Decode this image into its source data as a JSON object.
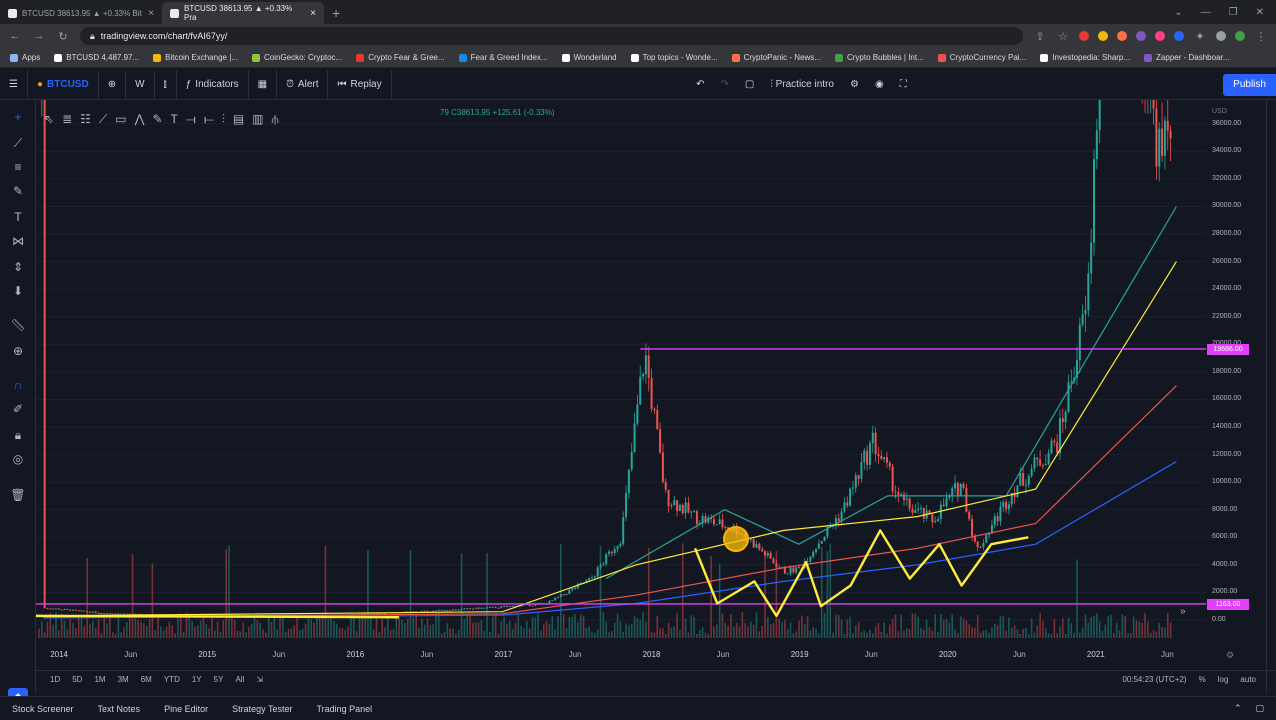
{
  "browser": {
    "tabs": [
      {
        "title": "BTCUSD 38613.95 ▲ +0.33% Bit",
        "active": false
      },
      {
        "title": "BTCUSD 38613.95 ▲ +0.33% Pra",
        "active": true
      }
    ],
    "new_tab": "+",
    "url": "tradingview.com/chart/fvAI67yy/",
    "bookmarks": [
      {
        "label": "Apps",
        "color": "#8ab4f8"
      },
      {
        "label": "BTCUSD 4,487.97...",
        "color": "#ffffff"
      },
      {
        "label": "Bitcoin Exchange |...",
        "color": "#f0b90b"
      },
      {
        "label": "CoinGecko: Cryptoc...",
        "color": "#8dc63f"
      },
      {
        "label": "Crypto Fear & Gree...",
        "color": "#e53935"
      },
      {
        "label": "Fear & Greed Index...",
        "color": "#1e88e5"
      },
      {
        "label": "Wonderland",
        "color": "#ffffff"
      },
      {
        "label": "Top topics - Wonde...",
        "color": "#ffffff"
      },
      {
        "label": "CryptoPanic - News...",
        "color": "#ff7043"
      },
      {
        "label": "Crypto Bubbles | Int...",
        "color": "#43a047"
      },
      {
        "label": "CryptoCurrency Pai...",
        "color": "#ef5350"
      },
      {
        "label": "Investopedia: Sharp...",
        "color": "#ffffff"
      },
      {
        "label": "Zapper - Dashboar...",
        "color": "#7e57c2"
      }
    ]
  },
  "tv": {
    "symbol": "BTCUSD",
    "interval": "W",
    "indicators": "Indicators",
    "alert": "Alert",
    "replay": "Replay",
    "practice": "Practice intro",
    "publish": "Publish",
    "legend": "79 C38613.95 +125.61 (-0.33%)",
    "currency": "USD"
  },
  "colors": {
    "background": "#131722",
    "up": "#26a69a",
    "down": "#ef5350",
    "accent": "#2962ff",
    "level": "#e040fb",
    "highlight": "#ffeb3b"
  },
  "chart_data": {
    "type": "line",
    "x_ticks": [
      "2014",
      "Jun",
      "2015",
      "Jun",
      "2016",
      "Jun",
      "2017",
      "Jun",
      "2018",
      "Jun",
      "2019",
      "Jun",
      "2020",
      "Jun",
      "2021",
      "Jun"
    ],
    "y_ticks": [
      "36000.00",
      "34000.00",
      "32000.00",
      "30000.00",
      "28000.00",
      "26000.00",
      "24000.00",
      "22000.00",
      "20000.00",
      "18000.00",
      "16000.00",
      "14000.00",
      "12000.00",
      "10000.00",
      "8000.00",
      "6000.00",
      "4000.00",
      "2000.00",
      "0.00"
    ],
    "ylim": [
      0,
      37000
    ],
    "price_tags": [
      {
        "label": "19666.00",
        "value": 19666
      },
      {
        "label": "1163.00",
        "value": 1163
      }
    ],
    "price_path": [
      [
        2013.9,
        900
      ],
      [
        2014.3,
        500
      ],
      [
        2015.0,
        250
      ],
      [
        2015.5,
        260
      ],
      [
        2016.0,
        420
      ],
      [
        2016.5,
        650
      ],
      [
        2017.0,
        950
      ],
      [
        2017.3,
        1200
      ],
      [
        2017.6,
        3000
      ],
      [
        2017.8,
        6000
      ],
      [
        2017.96,
        19500
      ],
      [
        2018.1,
        9000
      ],
      [
        2018.3,
        7500
      ],
      [
        2018.6,
        6500
      ],
      [
        2018.9,
        3500
      ],
      [
        2019.0,
        3700
      ],
      [
        2019.3,
        8000
      ],
      [
        2019.5,
        13000
      ],
      [
        2019.7,
        8500
      ],
      [
        2019.9,
        7200
      ],
      [
        2020.1,
        10000
      ],
      [
        2020.2,
        5000
      ],
      [
        2020.45,
        9500
      ],
      [
        2020.75,
        13000
      ],
      [
        2020.95,
        23000
      ],
      [
        2021.1,
        56000
      ],
      [
        2021.45,
        33000
      ],
      [
        2021.55,
        38600
      ]
    ],
    "ma_series": [
      {
        "color": "#26a69a",
        "values": [
          [
            2017.7,
            3000
          ],
          [
            2018.5,
            8000
          ],
          [
            2019.0,
            5500
          ],
          [
            2019.6,
            9000
          ],
          [
            2020.4,
            9000
          ],
          [
            2021.55,
            30000
          ]
        ]
      },
      {
        "color": "#ffeb3b",
        "values": [
          [
            2013.9,
            300
          ],
          [
            2017.0,
            600
          ],
          [
            2017.9,
            4000
          ],
          [
            2018.9,
            6500
          ],
          [
            2019.8,
            7500
          ],
          [
            2020.6,
            9500
          ],
          [
            2021.55,
            26000
          ]
        ]
      },
      {
        "color": "#ef5350",
        "values": [
          [
            2013.9,
            200
          ],
          [
            2017.0,
            450
          ],
          [
            2017.9,
            1800
          ],
          [
            2018.9,
            3800
          ],
          [
            2019.8,
            5200
          ],
          [
            2020.6,
            7000
          ],
          [
            2021.55,
            17000
          ]
        ]
      },
      {
        "color": "#2962ff",
        "values": [
          [
            2013.9,
            150
          ],
          [
            2017.0,
            350
          ],
          [
            2017.9,
            1200
          ],
          [
            2018.9,
            2800
          ],
          [
            2019.8,
            4000
          ],
          [
            2020.6,
            5500
          ],
          [
            2021.55,
            11500
          ]
        ]
      }
    ]
  },
  "ranges": [
    "1D",
    "5D",
    "1M",
    "3M",
    "6M",
    "YTD",
    "1Y",
    "5Y",
    "All"
  ],
  "clock": "00:54:23 (UTC+2)",
  "scale_toggles": [
    "%",
    "log",
    "auto"
  ],
  "bottom_tabs": [
    "Stock Screener",
    "Text Notes",
    "Pine Editor",
    "Strategy Tester",
    "Trading Panel"
  ]
}
